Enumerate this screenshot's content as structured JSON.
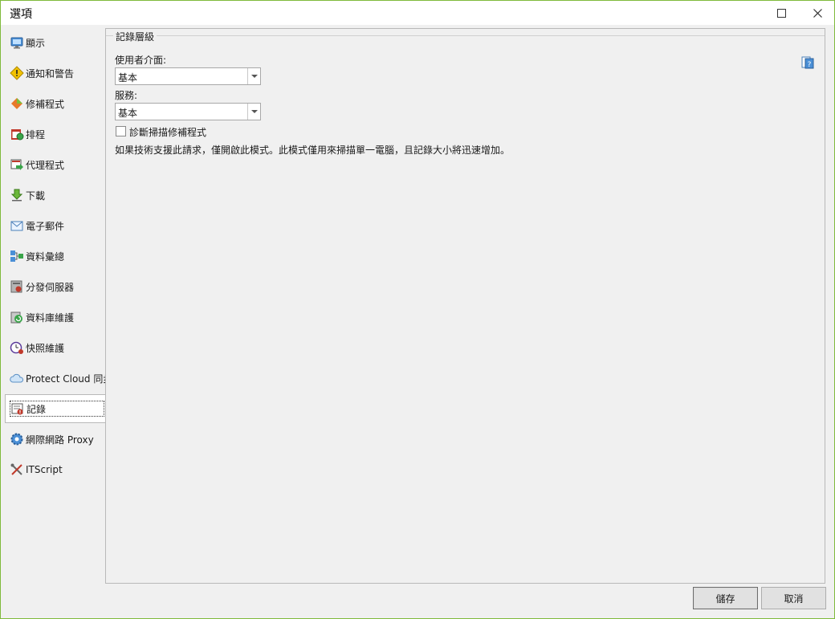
{
  "window": {
    "title": "選項"
  },
  "sidebar": {
    "items": [
      {
        "label": "顯示",
        "icon": "monitor-icon"
      },
      {
        "label": "通知和警告",
        "icon": "warning-icon"
      },
      {
        "label": "修補程式",
        "icon": "patch-icon"
      },
      {
        "label": "排程",
        "icon": "schedule-icon"
      },
      {
        "label": "代理程式",
        "icon": "agent-icon"
      },
      {
        "label": "下載",
        "icon": "download-icon"
      },
      {
        "label": "電子郵件",
        "icon": "email-icon"
      },
      {
        "label": "資料彙總",
        "icon": "data-rollup-icon"
      },
      {
        "label": "分發伺服器",
        "icon": "distribution-server-icon"
      },
      {
        "label": "資料庫維護",
        "icon": "database-maintenance-icon"
      },
      {
        "label": "快照維護",
        "icon": "snapshot-maintenance-icon"
      },
      {
        "label": "Protect Cloud 同步",
        "icon": "cloud-sync-icon"
      },
      {
        "label": "記錄",
        "icon": "log-icon"
      },
      {
        "label": "網際網路 Proxy",
        "icon": "gear-icon"
      },
      {
        "label": "ITScript",
        "icon": "tools-icon"
      }
    ],
    "selected": "記錄"
  },
  "main": {
    "group_title": "記錄層級",
    "ui_label": "使用者介面:",
    "ui_value": "基本",
    "service_label": "服務:",
    "service_value": "基本",
    "checkbox_label": "診斷掃描修補程式",
    "checkbox_checked": false,
    "description": "如果技術支援此請求，僅開啟此模式。此模式僅用來掃描單一電腦，且記錄大小將迅速增加。"
  },
  "footer": {
    "save_label": "儲存",
    "cancel_label": "取消"
  },
  "colors": {
    "window_border": "#7fba3c",
    "background": "#f0f0f0"
  }
}
